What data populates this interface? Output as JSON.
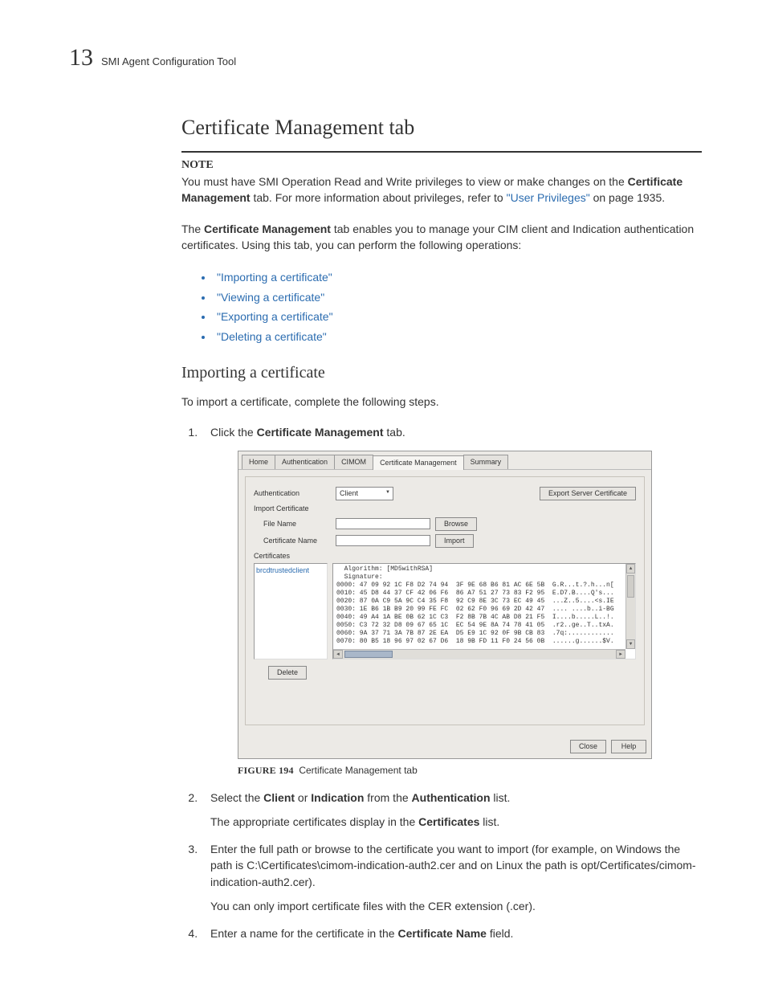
{
  "page": {
    "number": "13",
    "running_head": "SMI Agent Configuration Tool"
  },
  "section": {
    "title": "Certificate Management tab",
    "note_label": "NOTE",
    "note_pre": "You must have SMI Operation Read and Write privileges to view or make changes on the ",
    "note_bold1": "Certificate Management",
    "note_mid": " tab. For more information about privileges, refer to ",
    "note_xref": "\"User Privileges\"",
    "note_post": " on page 1935.",
    "intro_pre": "The ",
    "intro_bold": "Certificate Management",
    "intro_post": " tab enables you to manage your CIM client and Indication authentication certificates. Using this tab, you can perform the following operations:",
    "ops": [
      "\"Importing a certificate\"",
      "\"Viewing a certificate\"",
      "\"Exporting a certificate\"",
      "\"Deleting a certificate\""
    ]
  },
  "subsection": {
    "title": "Importing a certificate",
    "intro": "To import a certificate, complete the following steps.",
    "step1_pre": "Click the ",
    "step1_bold": "Certificate Management",
    "step1_post": " tab.",
    "step2_pre": "Select the ",
    "step2_b1": "Client",
    "step2_mid1": " or ",
    "step2_b2": "Indication",
    "step2_mid2": " from the ",
    "step2_b3": "Authentication",
    "step2_post": " list.",
    "step2_p2_pre": "The appropriate certificates display in the ",
    "step2_p2_bold": "Certificates",
    "step2_p2_post": " list.",
    "step3": "Enter the full path or browse to the certificate you want to import (for example, on Windows the path is C:\\Certificates\\cimom-indication-auth2.cer and on Linux the path is opt/Certificates/cimom-indication-auth2.cer).",
    "step3_p2": "You can only import certificate files with the CER extension (.cer).",
    "step4_pre": "Enter a name for the certificate in the ",
    "step4_bold": "Certificate Name",
    "step4_post": " field."
  },
  "figure": {
    "label": "FIGURE 194",
    "caption": "Certificate Management tab",
    "tabs": [
      "Home",
      "Authentication",
      "CIMOM",
      "Certificate Management",
      "Summary"
    ],
    "active_tab_index": 3,
    "auth_label": "Authentication",
    "auth_value": "Client",
    "export_btn": "Export Server Certificate",
    "import_group": "Import Certificate",
    "file_label": "File Name",
    "browse_btn": "Browse",
    "certname_label": "Certificate Name",
    "import_btn": "Import",
    "certs_label": "Certificates",
    "cert_item": "brcdtrustedclient",
    "delete_btn": "Delete",
    "close_btn": "Close",
    "help_btn": "Help",
    "hex_lines": [
      "  Algorithm: [MD5withRSA]",
      "  Signature:",
      "0000: 47 09 92 1C F8 D2 74 94  3F 9E 68 B6 81 AC 6E 5B  G.R...t.?.h...n[",
      "0010: 45 D8 44 37 CF 42 06 F6  86 A7 51 27 73 83 F2 95  E.D7.B....Q's...",
      "0020: 87 0A C9 5A 9C C4 35 F8  92 C9 8E 3C 73 EC 49 45  ...Z..5....<s.IE",
      "0030: 1E B6 1B B9 20 99 FE FC  02 62 F0 96 69 2D 42 47  .... ....b..i-BG",
      "0040: 49 A4 1A BE 0B 62 1C C3  F2 8B 7B 4C AB D8 21 F5  I....b.....L..!.",
      "0050: C3 72 32 D8 09 67 65 1C  EC 54 9E 8A 74 78 41 05  .r2..ge..T..txA.",
      "0060: 9A 37 71 3A 7B 87 2E EA  D5 E9 1C 92 0F 9B CB 83  .7q:............",
      "0070: 80 B5 18 96 97 02 67 D6  18 9B FD 11 F0 24 56 0B  ......g......$V.",
      "",
      "]"
    ]
  }
}
